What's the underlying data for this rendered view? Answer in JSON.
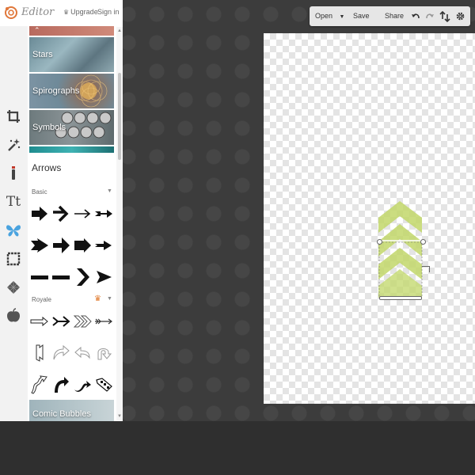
{
  "header": {
    "app_title": "Editor",
    "upgrade_label": "Upgrade",
    "signin_label": "Sign in",
    "logo_color": "#e0773a"
  },
  "toolbar": {
    "tools": [
      {
        "name": "crop-tool",
        "icon": "crop-icon"
      },
      {
        "name": "effects-tool",
        "icon": "magic-wand-icon"
      },
      {
        "name": "touch-up-tool",
        "icon": "brush-icon"
      },
      {
        "name": "text-tool",
        "icon": "text-icon",
        "label": "Tt"
      },
      {
        "name": "overlays-tool",
        "icon": "butterfly-icon",
        "active": true,
        "accent": "#4aa3df"
      },
      {
        "name": "frames-tool",
        "icon": "frame-icon"
      },
      {
        "name": "textures-tool",
        "icon": "texture-icon"
      },
      {
        "name": "seasonal-tool",
        "icon": "apple-icon"
      }
    ]
  },
  "panel": {
    "categories_above": [
      "Stars",
      "Spirographs",
      "Symbols"
    ],
    "category_below": "Comic Bubbles",
    "open_category": "Arrows",
    "sections": [
      {
        "name": "Basic"
      },
      {
        "name": "Royale",
        "badge_icon": "crown-icon",
        "badge_color": "#e07a2e"
      }
    ]
  },
  "topbar": {
    "open_label": "Open",
    "save_label": "Save",
    "share_label": "Share"
  },
  "canvas": {
    "shape_color": "#c2d86a"
  }
}
